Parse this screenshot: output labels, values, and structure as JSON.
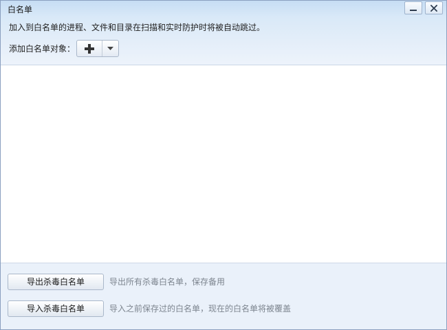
{
  "window": {
    "title": "白名单",
    "minimize_icon": "minimize-icon",
    "close_icon": "close-icon"
  },
  "header": {
    "description": "加入到白名单的进程、文件和目录在扫描和实时防护时将被自动跳过。",
    "add_label": "添加白名单对象：",
    "add_icon": "plus-icon",
    "dropdown_icon": "caret-down-icon"
  },
  "whitelist": {
    "items": []
  },
  "footer": {
    "export_button": "导出杀毒白名单",
    "export_hint": "导出所有杀毒白名单，保存备用",
    "import_button": "导入杀毒白名单",
    "import_hint": "导入之前保存过的白名单，现在的白名单将被覆盖"
  },
  "colors": {
    "header_gradient_top": "#c6ddf4",
    "footer_background": "#eaf1fa",
    "hint_text": "#7d858f"
  }
}
